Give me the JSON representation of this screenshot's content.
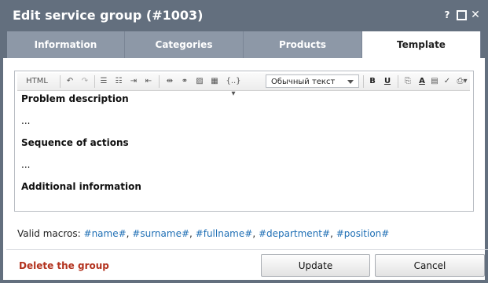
{
  "dialog": {
    "title": "Edit service group (#1003)",
    "help_label": "?",
    "close_label": "✕"
  },
  "tabs": [
    {
      "label": "Information"
    },
    {
      "label": "Categories"
    },
    {
      "label": "Products"
    },
    {
      "label": "Template"
    }
  ],
  "editor": {
    "toolbar": {
      "html_label": "HTML",
      "format_value": "Обычный текст",
      "bold_label": "B",
      "underline_label": "U",
      "var_label": "{..}"
    },
    "content": [
      {
        "text": "Problem description",
        "bold": true
      },
      {
        "text": "...",
        "bold": false
      },
      {
        "text": "Sequence of actions",
        "bold": true
      },
      {
        "text": "...",
        "bold": false
      },
      {
        "text": "Additional information",
        "bold": true
      }
    ]
  },
  "macros": {
    "label": "Valid macros:",
    "items": [
      "#name#",
      "#surname#",
      "#fullname#",
      "#department#",
      "#position#"
    ]
  },
  "footer": {
    "delete_label": "Delete the group",
    "update_label": "Update",
    "cancel_label": "Cancel"
  },
  "colors": {
    "titlebar": "#636f7e",
    "tab_inactive": "#8d98a7",
    "tab_active": "#ffffff",
    "link": "#1f6fb5",
    "danger": "#b3321e"
  }
}
